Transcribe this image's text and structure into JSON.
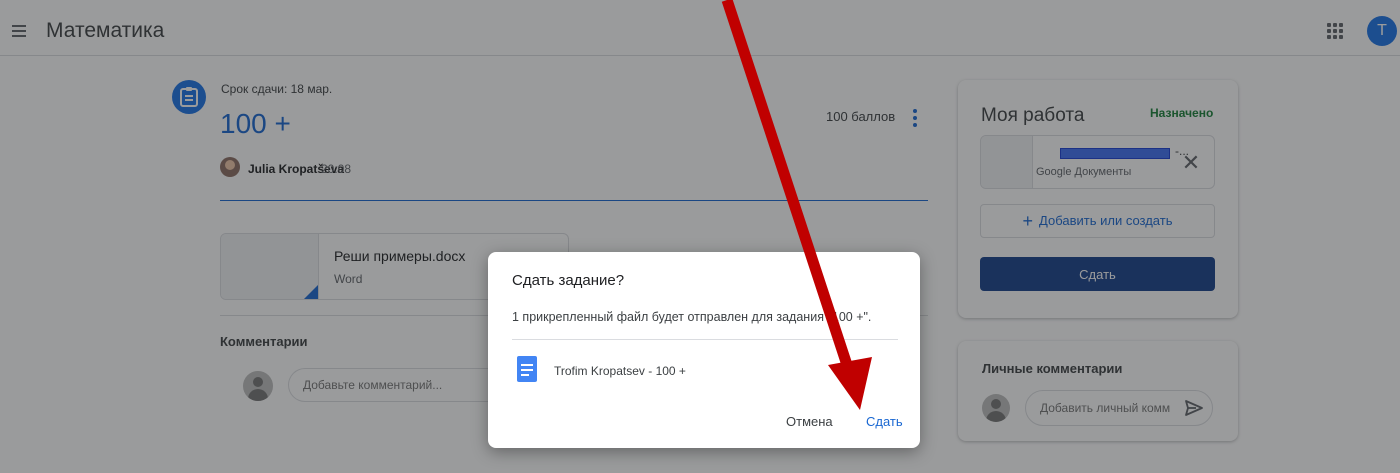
{
  "header": {
    "title": "Математика",
    "avatar_letter": "T"
  },
  "assignment": {
    "due": "Срок сдачи: 18 мар.",
    "title": "100 +",
    "points": "100 баллов",
    "author": "Julia Kropatševa",
    "time": "20:08",
    "attachment": {
      "name": "Реши примеры.docx",
      "type": "Word"
    }
  },
  "comments": {
    "label": "Комментарии",
    "placeholder": "Добавьте комментарий..."
  },
  "my_work": {
    "title": "Моя работа",
    "status": "Назначено",
    "file_name_suffix": "-...",
    "file_type": "Google Документы",
    "add_label": "Добавить или создать",
    "submit_label": "Сдать"
  },
  "private_comments": {
    "title": "Личные комментарии",
    "placeholder": "Добавить личный комм"
  },
  "dialog": {
    "title": "Сдать задание?",
    "body": "1 прикрепленный файл будет отправлен для задания \"100 +\".",
    "file_name": "Trofim Kropatsev - 100 +",
    "cancel_label": "Отмена",
    "submit_label": "Сдать"
  },
  "colors": {
    "accent": "#1967d2",
    "submit_bg": "#17408b",
    "status_green": "#188038",
    "annotation_red": "#c00000"
  },
  "icons": {
    "menu": "hamburger-menu-icon",
    "apps": "apps-grid-icon",
    "assignment": "assignment-icon",
    "more": "more-vert-icon",
    "close": "close-icon",
    "add": "plus-icon",
    "send": "send-icon",
    "doc": "google-docs-icon"
  }
}
